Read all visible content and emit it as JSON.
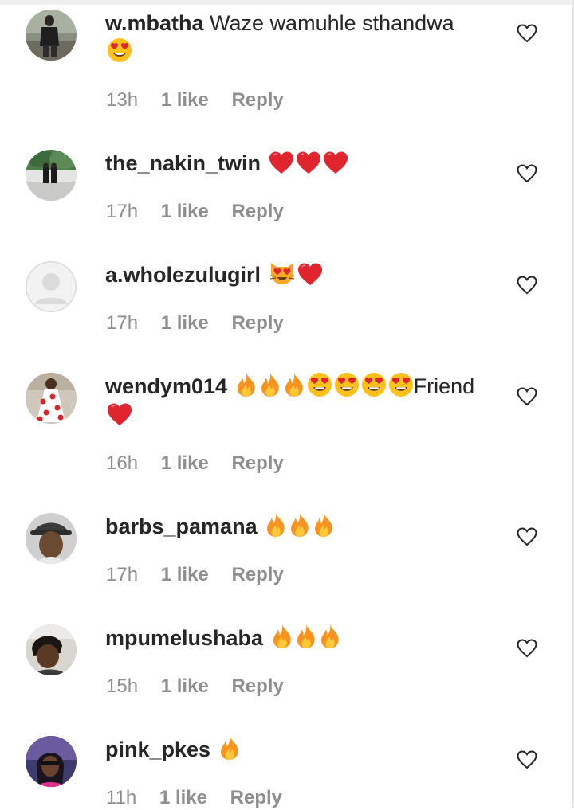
{
  "comments": [
    {
      "username": "w.mbatha",
      "text": "Waze wamuhle sthandwa",
      "emojis_line2": "😍",
      "time": "13h",
      "likes": "1 like",
      "reply": "Reply",
      "avatar": "photo-person-outdoors"
    },
    {
      "username": "the_nakin_twin",
      "text": "",
      "emojis": "❤❤❤",
      "time": "17h",
      "likes": "1 like",
      "reply": "Reply",
      "avatar": "photo-two-people-trees"
    },
    {
      "username": "a.wholezulugirl",
      "text": "",
      "emojis": "😻❤",
      "time": "17h",
      "likes": "1 like",
      "reply": "Reply",
      "avatar": "default-profile-silhouette"
    },
    {
      "username": "wendym014",
      "text": "Friend",
      "emojis": "🔥🔥🔥😍😍😍😍",
      "emojis_line2": "❤",
      "time": "16h",
      "likes": "1 like",
      "reply": "Reply",
      "avatar": "photo-woman-red-dress"
    },
    {
      "username": "barbs_pamana",
      "text": "",
      "emojis": "🔥🔥🔥",
      "time": "17h",
      "likes": "1 like",
      "reply": "Reply",
      "avatar": "photo-woman-cap"
    },
    {
      "username": "mpumelushaba",
      "text": "",
      "emojis": "🔥🔥🔥",
      "time": "15h",
      "likes": "1 like",
      "reply": "Reply",
      "avatar": "photo-person-selfie"
    },
    {
      "username": "pink_pkes",
      "text": "",
      "emojis": "🔥",
      "time": "11h",
      "likes": "1 like",
      "reply": "Reply",
      "avatar": "photo-woman-pink"
    }
  ],
  "colors": {
    "text": "#262626",
    "meta": "#8e8e8e",
    "heart_emoji": "#e0252e",
    "fire": "#f7931e",
    "face": "#fcc21b"
  },
  "icons": {
    "like": "heart-outline-icon"
  }
}
